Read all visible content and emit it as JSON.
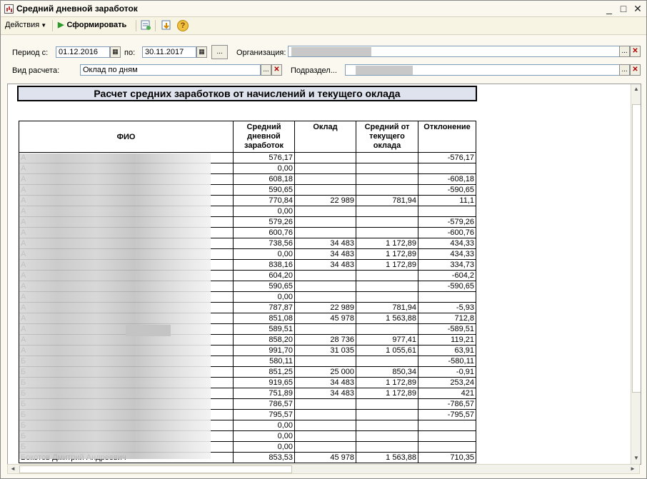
{
  "window": {
    "title": "Средний дневной заработок",
    "minimize_glyph": "_",
    "maximize_glyph": "□",
    "close_glyph": "✕"
  },
  "toolbar": {
    "actions_label": "Действия",
    "form_label": "Сформировать",
    "help_glyph": "?"
  },
  "filters": {
    "period_label": "Период с:",
    "period_from": "01.12.2016",
    "period_to_label": "по:",
    "period_to": "30.11.2017",
    "org_label": "Организация:",
    "calc_type_label": "Вид расчета:",
    "calc_type_value": "Оклад по дням",
    "dept_label": "Подраздел...",
    "select_glyph": "...",
    "clear_glyph": "✕"
  },
  "report": {
    "title": "Расчет средних заработков от начислений и текущего оклада",
    "headers": {
      "fio": "ФИО",
      "avg": "Средний дневной заработок",
      "salary": "Оклад",
      "avg_current": "Средний от текущего оклада",
      "deviation": "Отклонение"
    },
    "rows": [
      {
        "fio": "А",
        "avg": "576,17",
        "salary": "",
        "avg_current": "",
        "deviation": "-576,17"
      },
      {
        "fio": "А",
        "avg": "0,00",
        "salary": "",
        "avg_current": "",
        "deviation": ""
      },
      {
        "fio": "А",
        "avg": "608,18",
        "salary": "",
        "avg_current": "",
        "deviation": "-608,18"
      },
      {
        "fio": "А",
        "avg": "590,65",
        "salary": "",
        "avg_current": "",
        "deviation": "-590,65"
      },
      {
        "fio": "А",
        "avg": "770,84",
        "salary": "22 989",
        "avg_current": "781,94",
        "deviation": "11,1"
      },
      {
        "fio": "А",
        "avg": "0,00",
        "salary": "",
        "avg_current": "",
        "deviation": ""
      },
      {
        "fio": "А",
        "avg": "579,26",
        "salary": "",
        "avg_current": "",
        "deviation": "-579,26"
      },
      {
        "fio": "А",
        "avg": "600,76",
        "salary": "",
        "avg_current": "",
        "deviation": "-600,76"
      },
      {
        "fio": "А",
        "avg": "738,56",
        "salary": "34 483",
        "avg_current": "1 172,89",
        "deviation": "434,33"
      },
      {
        "fio": "А",
        "avg": "0,00",
        "salary": "34 483",
        "avg_current": "1 172,89",
        "deviation": "434,33"
      },
      {
        "fio": "А",
        "avg": "838,16",
        "salary": "34 483",
        "avg_current": "1 172,89",
        "deviation": "334,73"
      },
      {
        "fio": "А",
        "avg": "604,20",
        "salary": "",
        "avg_current": "",
        "deviation": "-604,2"
      },
      {
        "fio": "А",
        "avg": "590,65",
        "salary": "",
        "avg_current": "",
        "deviation": "-590,65"
      },
      {
        "fio": "А",
        "avg": "0,00",
        "salary": "",
        "avg_current": "",
        "deviation": ""
      },
      {
        "fio": "А",
        "avg": "787,87",
        "salary": "22 989",
        "avg_current": "781,94",
        "deviation": "-5,93"
      },
      {
        "fio": "А",
        "avg": "851,08",
        "salary": "45 978",
        "avg_current": "1 563,88",
        "deviation": "712,8"
      },
      {
        "fio": "А",
        "avg": "589,51",
        "salary": "",
        "avg_current": "",
        "deviation": "-589,51"
      },
      {
        "fio": "А",
        "avg": "858,20",
        "salary": "28 736",
        "avg_current": "977,41",
        "deviation": "119,21"
      },
      {
        "fio": "А",
        "avg": "991,70",
        "salary": "31 035",
        "avg_current": "1 055,61",
        "deviation": "63,91"
      },
      {
        "fio": "Б",
        "avg": "580,11",
        "salary": "",
        "avg_current": "",
        "deviation": "-580,11"
      },
      {
        "fio": "Б",
        "avg": "851,25",
        "salary": "25 000",
        "avg_current": "850,34",
        "deviation": "-0,91"
      },
      {
        "fio": "Б",
        "avg": "919,65",
        "salary": "34 483",
        "avg_current": "1 172,89",
        "deviation": "253,24"
      },
      {
        "fio": "Б",
        "avg": "751,89",
        "salary": "34 483",
        "avg_current": "1 172,89",
        "deviation": "421"
      },
      {
        "fio": "Б",
        "avg": "786,57",
        "salary": "",
        "avg_current": "",
        "deviation": "-786,57"
      },
      {
        "fio": "Б",
        "avg": "795,57",
        "salary": "",
        "avg_current": "",
        "deviation": "-795,57"
      },
      {
        "fio": "Б",
        "avg": "0,00",
        "salary": "",
        "avg_current": "",
        "deviation": ""
      },
      {
        "fio": "Б",
        "avg": "0,00",
        "salary": "",
        "avg_current": "",
        "deviation": ""
      },
      {
        "fio": "Б",
        "avg": "0,00",
        "salary": "",
        "avg_current": "",
        "deviation": ""
      },
      {
        "fio": "Бокотов Дмитрий Андреевич",
        "avg": "853,53",
        "salary": "45 978",
        "avg_current": "1 563,88",
        "deviation": "710,35"
      }
    ]
  },
  "scroll": {
    "up": "▲",
    "down": "▼",
    "left": "◄",
    "right": "►"
  }
}
